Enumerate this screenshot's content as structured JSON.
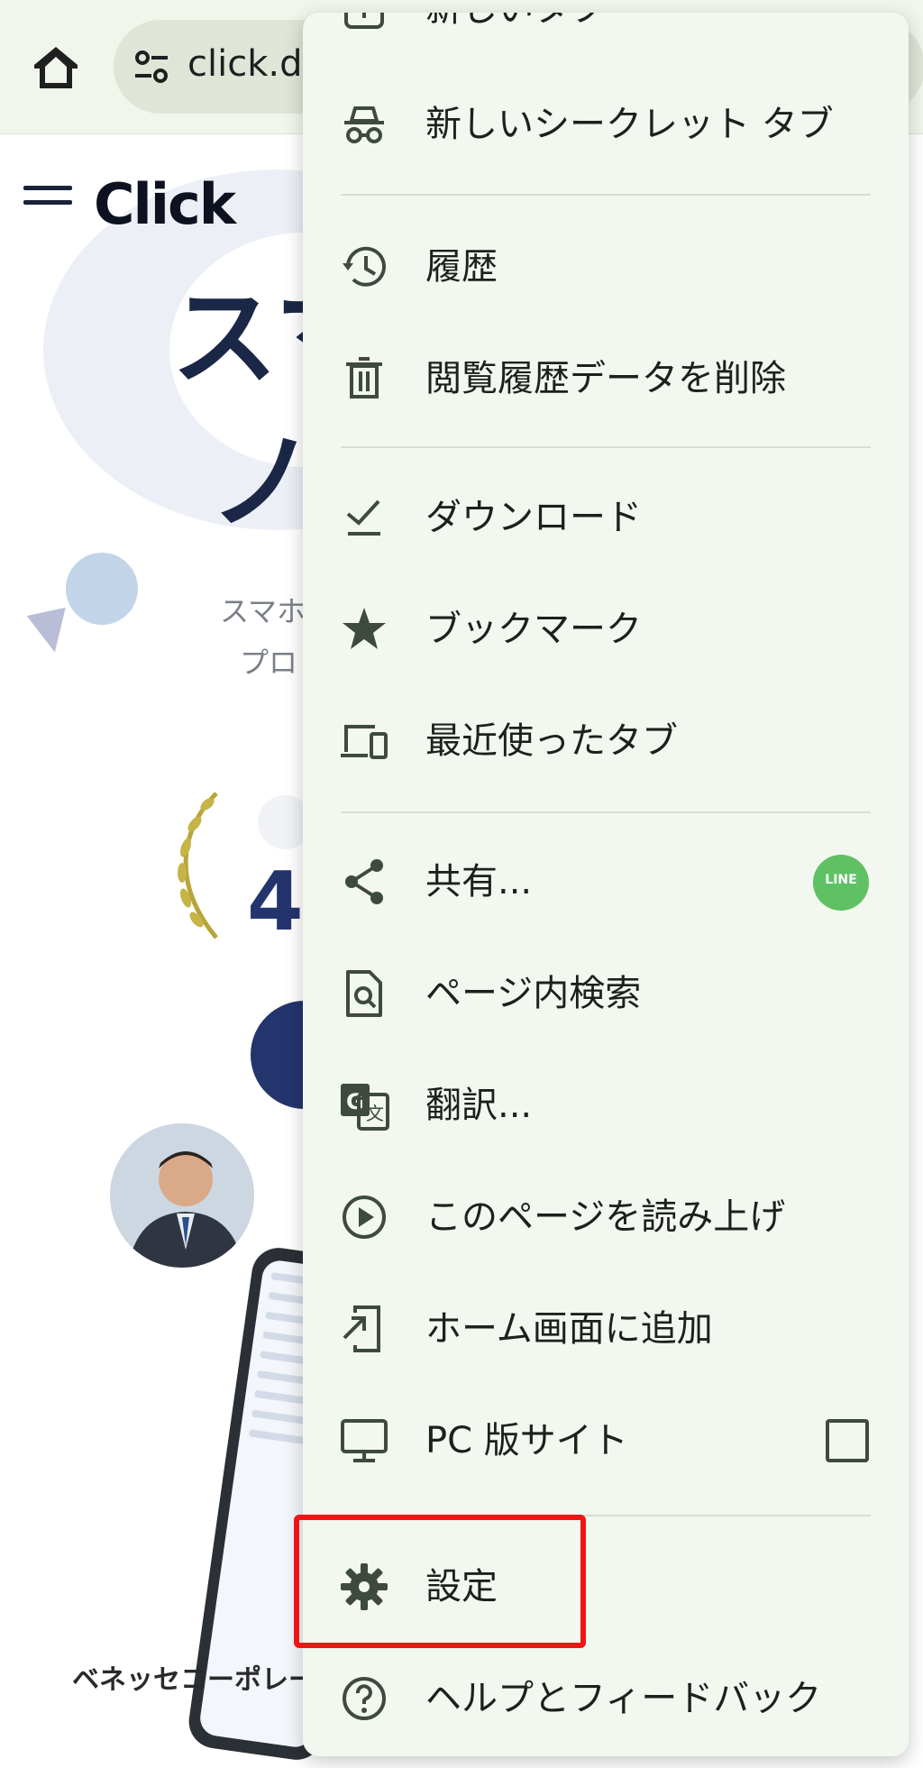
{
  "browser": {
    "url_text": "click.de",
    "home_icon": "home-icon",
    "site_info_icon": "tune-icon"
  },
  "page": {
    "logo_text": "Click",
    "hero_line1": "スマ",
    "hero_line2": "ノ",
    "subtitle_line1": "スマホ",
    "subtitle_line2": "プロ",
    "rating_text": "4",
    "company_text": "ベネッセコーポレーシ"
  },
  "menu": {
    "partial_top_label": "新しいタブ",
    "items": [
      {
        "label": "新しいシークレット タブ",
        "icon": "incognito-icon"
      },
      {
        "label": "履歴",
        "icon": "history-icon"
      },
      {
        "label": "閲覧履歴データを削除",
        "icon": "trash-icon"
      },
      {
        "label": "ダウンロード",
        "icon": "download-done-icon"
      },
      {
        "label": "ブックマーク",
        "icon": "star-icon"
      },
      {
        "label": "最近使ったタブ",
        "icon": "devices-icon"
      },
      {
        "label": "共有...",
        "icon": "share-icon",
        "badge": "LINE"
      },
      {
        "label": "ページ内検索",
        "icon": "find-in-page-icon"
      },
      {
        "label": "翻訳...",
        "icon": "translate-icon"
      },
      {
        "label": "このページを読み上げ",
        "icon": "play-circle-icon"
      },
      {
        "label": "ホーム画面に追加",
        "icon": "add-to-home-icon"
      },
      {
        "label": "PC 版サイト",
        "icon": "desktop-icon",
        "checked": false
      },
      {
        "label": "設定",
        "icon": "gear-icon",
        "highlighted": true
      },
      {
        "label": "ヘルプとフィードバック",
        "icon": "help-icon"
      }
    ]
  },
  "colors": {
    "menu_bg": "#f2f7ef",
    "highlight_border": "#f01515",
    "line_green": "#5fc164",
    "brand_navy": "#24356e"
  }
}
